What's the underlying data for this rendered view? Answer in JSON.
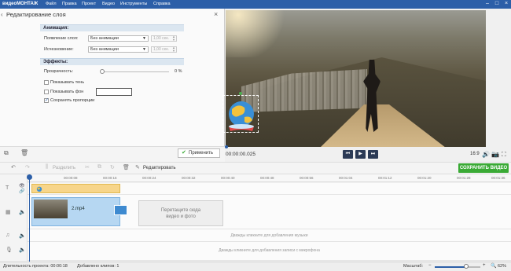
{
  "app": {
    "logo_prefix": "видео",
    "logo_suffix": "МОНТАЖ"
  },
  "menu": [
    "Файл",
    "Правка",
    "Проект",
    "Видео",
    "Инструменты",
    "Справка"
  ],
  "panel": {
    "title": "Редактирование слоя",
    "animation_header": "Анимация:",
    "appear_label": "Появление слоя:",
    "appear_value": "Без анимации",
    "appear_dur": "1,00 сек.",
    "disappear_label": "Исчезновение:",
    "disappear_value": "Без анимации",
    "disappear_dur": "1,00 сек.",
    "effects_header": "Эффекты:",
    "opacity_label": "Прозрачность:",
    "opacity_value": "0 %",
    "opacity_level": 0,
    "shadow_label": "Показывать тень",
    "shadow_checked": false,
    "bg_label": "Показывать фон",
    "bg_checked": false,
    "bg_color": "#ffffff",
    "keep_ratio_label": "Сохранять пропорции",
    "keep_ratio_checked": true,
    "apply_label": "Применить"
  },
  "player": {
    "time": "00:00:00.025",
    "ratio": "16:9"
  },
  "toolbar": {
    "split_label": "Разделить",
    "edit_label": "Редактировать",
    "save_label": "СОХРАНИТЬ ВИДЕО"
  },
  "timeline": {
    "ticks": [
      "00:00:08",
      "00:00:16",
      "00:00:24",
      "00:00:32",
      "00:00:40",
      "00:00:48",
      "00:00:56",
      "00:01:04",
      "00:01:12",
      "00:01:20",
      "00:01:28",
      "00:01:36"
    ],
    "clip_name": "2.mp4",
    "drop_line1": "Перетащите сюда",
    "drop_line2": "видео и фото",
    "music_hint": "Дважды кликните для добавления музыки",
    "mic_hint": "Дважды кликните для добавления записи с микрофона"
  },
  "status": {
    "duration": "Длительность проекта:  00:00:18",
    "clips": "Добавлено клипов: 1",
    "zoom_label": "Масштаб:",
    "zoom_pct": "62%",
    "zoom_level": 0.62
  },
  "colors": {
    "accent": "#2c5fa8",
    "save": "#3aaa35",
    "title_clip": "#f7d58a",
    "video_clip": "#b6d7f2"
  }
}
